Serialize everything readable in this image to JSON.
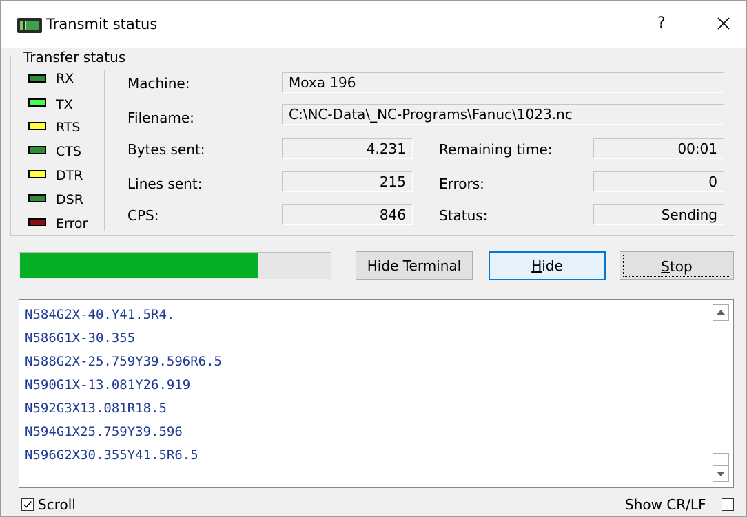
{
  "window": {
    "title": "Transmit status",
    "help": "?",
    "close": "×"
  },
  "group": {
    "label": "Transfer status"
  },
  "leds": [
    {
      "label": "RX",
      "color": "#2f8a3a"
    },
    {
      "label": "TX",
      "color": "#48ff48"
    },
    {
      "label": "RTS",
      "color": "#ffff40"
    },
    {
      "label": "CTS",
      "color": "#2f8a3a"
    },
    {
      "label": "DTR",
      "color": "#ffff40"
    },
    {
      "label": "DSR",
      "color": "#2f8a3a"
    },
    {
      "label": "Error",
      "color": "#8a0f0f"
    }
  ],
  "info": {
    "machine_label": "Machine:",
    "machine_value": "Moxa 196",
    "filename_label": "Filename:",
    "filename_value": "C:\\NC-Data\\_NC-Programs\\Fanuc\\1023.nc",
    "bytes_label": "Bytes sent:",
    "bytes_value": "4.231",
    "lines_label": "Lines sent:",
    "lines_value": "215",
    "cps_label": "CPS:",
    "cps_value": "846",
    "remaining_label": "Remaining time:",
    "remaining_value": "00:01",
    "errors_label": "Errors:",
    "errors_value": "0",
    "status_label": "Status:",
    "status_value": "Sending"
  },
  "progress": {
    "fraction": 0.77,
    "color": "#06b025"
  },
  "buttons": {
    "hide_terminal": "Hide Terminal",
    "hide_mnemonic": "H",
    "hide_rest": "ide",
    "stop_mnemonic": "S",
    "stop_rest": "top"
  },
  "terminal": {
    "lines": [
      "N584G2X-40.Y41.5R4.",
      "N586G1X-30.355",
      "N588G2X-25.759Y39.596R6.5",
      "N590G1X-13.081Y26.919",
      "N592G3X13.081R18.5",
      "N594G1X25.759Y39.596",
      "N596G2X30.355Y41.5R6.5"
    ]
  },
  "footer": {
    "scroll_label": "Scroll",
    "scroll_checked": true,
    "crlf_label": "Show CR/LF",
    "crlf_checked": false
  }
}
